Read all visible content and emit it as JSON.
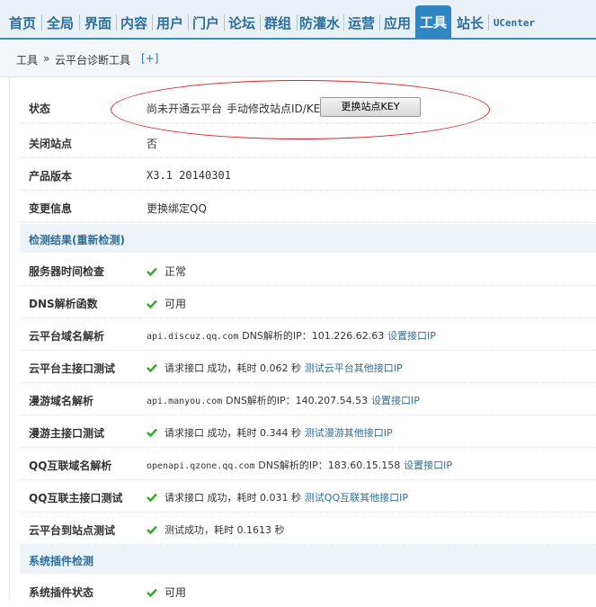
{
  "nav": {
    "tabs": [
      {
        "label": "首页"
      },
      {
        "label": "全局"
      },
      {
        "label": "界面"
      },
      {
        "label": "内容"
      },
      {
        "label": "用户"
      },
      {
        "label": "门户"
      },
      {
        "label": "论坛"
      },
      {
        "label": "群组"
      },
      {
        "label": "防灌水"
      },
      {
        "label": "运营"
      },
      {
        "label": "应用"
      },
      {
        "label": "工具",
        "active": true
      },
      {
        "label": "站长"
      },
      {
        "label": "UCenter"
      }
    ]
  },
  "breadcrumb": {
    "root": "工具",
    "sep": "»",
    "current": "云平台诊断工具",
    "expand": "[+]"
  },
  "status": {
    "label": "状态",
    "text": "尚未开通云平台",
    "link": "手动修改站点ID/KEY",
    "button": "更换站点KEY"
  },
  "rows": {
    "close_site": {
      "label": "关闭站点",
      "value": "否"
    },
    "version": {
      "label": "产品版本",
      "value": "X3.1 20140301"
    },
    "change_info": {
      "label": "变更信息",
      "link": "更换绑定QQ"
    }
  },
  "section1": {
    "title": "检测结果(重新检测)"
  },
  "checks": {
    "time": {
      "label": "服务器时间检查",
      "value": "正常"
    },
    "dns": {
      "label": "DNS解析函数",
      "value": "可用"
    },
    "cloud_dns": {
      "label": "云平台域名解析",
      "domain": "api.discuz.qq.com",
      "text": "DNS解析的IP：101.226.62.63",
      "link": "设置接口IP"
    },
    "cloud_api": {
      "label": "云平台主接口测试",
      "text": "请求接口 成功，耗时 0.062 秒",
      "link": "测试云平台其他接口IP"
    },
    "manyou_dns": {
      "label": "漫游域名解析",
      "domain": "api.manyou.com",
      "text": "DNS解析的IP：140.207.54.53",
      "link": "设置接口IP"
    },
    "manyou_api": {
      "label": "漫游主接口测试",
      "text": "请求接口 成功，耗时 0.344 秒",
      "link": "测试漫游其他接口IP"
    },
    "qq_dns": {
      "label": "QQ互联域名解析",
      "domain": "openapi.qzone.qq.com",
      "text": "DNS解析的IP：183.60.15.158",
      "link": "设置接口IP"
    },
    "qq_api": {
      "label": "QQ互联主接口测试",
      "text": "请求接口 成功，耗时 0.031 秒",
      "link": "测试QQ互联其他接口IP"
    },
    "cloud_site": {
      "label": "云平台到站点测试",
      "text": "测试成功，耗时 0.1613 秒"
    }
  },
  "section2": {
    "title": "系统插件检测"
  },
  "plugin": {
    "label": "系统插件状态",
    "value": "可用"
  },
  "colors": {
    "accent": "#2f86c2",
    "link": "#2b6f9e",
    "check": "#3aa82f",
    "annotation": "#d9232a"
  }
}
